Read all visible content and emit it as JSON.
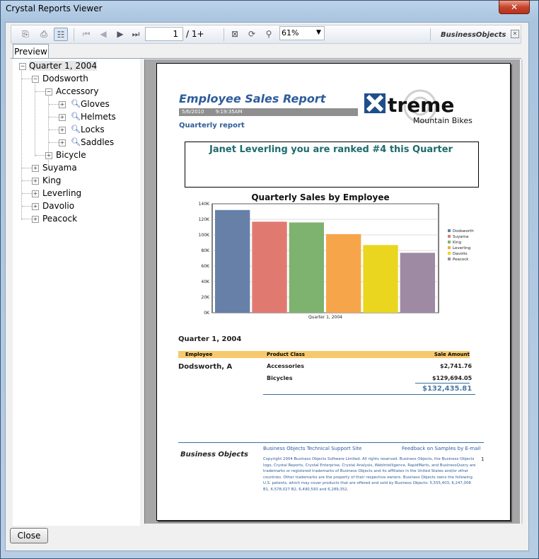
{
  "window": {
    "title": "Crystal Reports Viewer",
    "close_glyph": "✕"
  },
  "toolbar": {
    "page_current": "1",
    "page_total": "/ 1+",
    "zoom": "61%",
    "vendor_logo": "BusinessObjects"
  },
  "tabs": {
    "preview": "Preview"
  },
  "tree": {
    "root": "Quarter 1, 2004",
    "level1": [
      "Dodsworth",
      "Suyama",
      "King",
      "Leverling",
      "Davolio",
      "Peacock"
    ],
    "accessory": "Accessory",
    "accessory_items": [
      "Gloves",
      "Helmets",
      "Locks",
      "Saddles"
    ],
    "bicycle": "Bicycle"
  },
  "report": {
    "title": "Employee Sales Report",
    "date": "5/6/2010",
    "time": "9:19:35AM",
    "subtitle": "Quarterly report",
    "logo_word": "treme",
    "logo_sub": "Mountain Bikes",
    "rank_message": "Janet Leverling you are ranked #4 this Quarter",
    "group_header": "Quarter 1, 2004",
    "table_headers": {
      "employee": "Employee",
      "product_class": "Product Class",
      "sale_amount": "Sale Amount"
    },
    "rows": [
      {
        "employee": "Dodsworth, A",
        "product_class": "Accessories",
        "amount": "$2,741.76"
      },
      {
        "employee": "",
        "product_class": "Bicycles",
        "amount": "$129,694.05"
      }
    ],
    "total": "$132,435.81",
    "footer": {
      "logo": "Business Objects",
      "support_link": "Business Objects Technical Support Site",
      "feedback_link": "Feedback on Samples by E-mail",
      "page_number": "1",
      "copyright": "Copyright 2004 Business Objects Software Limited. All rights reserved. Business Objects, the Business Objects logo, Crystal Reports, Crystal Enterprise, Crystal Analysis, WebIntelligence, RapidMarts, and BusinessQuery are trademarks or registered trademarks of Business Objects and its affiliates in the United States and/or other countries. Other trademarks are the property of their respective owners. Business Objects owns the following U.S. patents, which may cover products that are offered and sold by Business Objects: 5,555,403, 6,247,008 B1, 6,578,027 B2, 6,490,593 and 6,289,352."
    }
  },
  "chart_data": {
    "type": "bar",
    "title": "Quarterly Sales by Employee",
    "categories": [
      "Quarter 1, 2004"
    ],
    "series": [
      {
        "name": "Dodsworth",
        "values": [
          132000
        ],
        "color": "#6680a8"
      },
      {
        "name": "Suyama",
        "values": [
          117000
        ],
        "color": "#e07a70"
      },
      {
        "name": "King",
        "values": [
          116000
        ],
        "color": "#7db36f"
      },
      {
        "name": "Leverling",
        "values": [
          101000
        ],
        "color": "#f7a54a"
      },
      {
        "name": "Davolio",
        "values": [
          87000
        ],
        "color": "#ead61e"
      },
      {
        "name": "Peacock",
        "values": [
          77000
        ],
        "color": "#9e8aa3"
      }
    ],
    "yticks": [
      "0K",
      "20K",
      "40K",
      "60K",
      "80K",
      "100K",
      "120K",
      "140K"
    ],
    "ylim": [
      0,
      140000
    ],
    "legend": "right"
  },
  "buttons": {
    "close": "Close"
  }
}
